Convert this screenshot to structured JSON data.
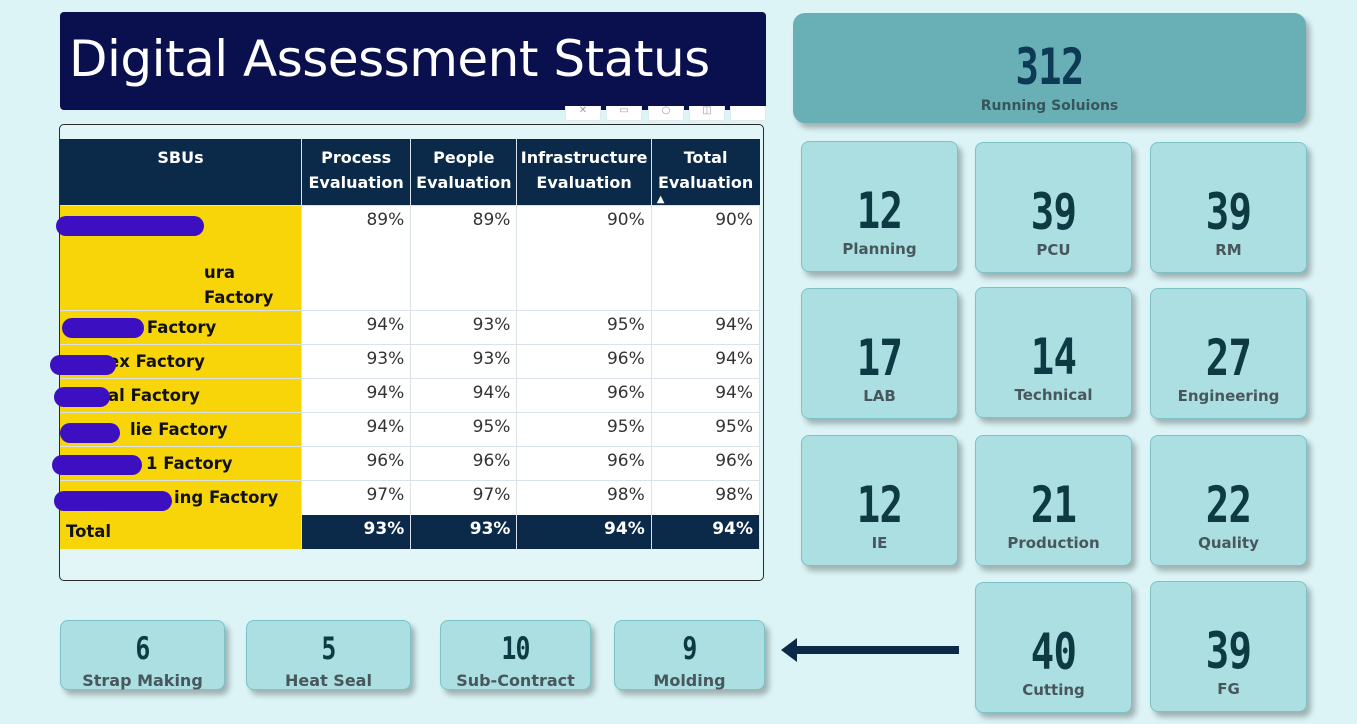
{
  "title": "Digital Assessment Status",
  "hero": {
    "value": "312",
    "label": "Running Soluions"
  },
  "table": {
    "headers": {
      "sbu": "SBUs",
      "process": "Process Evaluation",
      "people": "People Evaluation",
      "infra": "Infrastructure Evaluation",
      "total": "Total Evaluation"
    },
    "rows": [
      {
        "name": "ura\nFactory",
        "process": "89%",
        "people": "89%",
        "infra": "90%",
        "total": "90%"
      },
      {
        "name": "e Factory",
        "process": "94%",
        "people": "93%",
        "infra": "95%",
        "total": "94%"
      },
      {
        "name": "ex Factory",
        "process": "93%",
        "people": "93%",
        "infra": "96%",
        "total": "94%"
      },
      {
        "name": "al Factory",
        "process": "94%",
        "people": "94%",
        "infra": "96%",
        "total": "94%"
      },
      {
        "name": "lie Factory",
        "process": "94%",
        "people": "95%",
        "infra": "95%",
        "total": "95%"
      },
      {
        "name": "1 Factory",
        "process": "96%",
        "people": "96%",
        "infra": "96%",
        "total": "96%"
      },
      {
        "name": "ing Factory",
        "process": "97%",
        "people": "97%",
        "infra": "98%",
        "total": "98%"
      }
    ],
    "total": {
      "name": "Total",
      "process": "93%",
      "people": "93%",
      "infra": "94%",
      "total": "94%"
    }
  },
  "departments": [
    {
      "value": "12",
      "label": "Planning"
    },
    {
      "value": "39",
      "label": "PCU"
    },
    {
      "value": "39",
      "label": "RM"
    },
    {
      "value": "17",
      "label": "LAB"
    },
    {
      "value": "14",
      "label": "Technical"
    },
    {
      "value": "27",
      "label": "Engineering"
    },
    {
      "value": "12",
      "label": "IE"
    },
    {
      "value": "21",
      "label": "Production"
    },
    {
      "value": "22",
      "label": "Quality"
    },
    {
      "value": "40",
      "label": "Cutting"
    },
    {
      "value": "39",
      "label": "FG"
    }
  ],
  "sub_departments": [
    {
      "value": "6",
      "label": "Strap Making"
    },
    {
      "value": "5",
      "label": "Heat Seal"
    },
    {
      "value": "10",
      "label": "Sub-Contract"
    },
    {
      "value": "9",
      "label": "Molding"
    }
  ],
  "colors": {
    "background": "#dcf4f6",
    "title_bg": "#0a0f4d",
    "header_bg": "#0b2a4a",
    "sbu_highlight": "#f8d508",
    "card_bg": "#acdfe1",
    "hero_bg": "#68b0b5",
    "redaction": "#3c10c0"
  },
  "icons": {
    "arrow": "arrow-left-icon"
  }
}
